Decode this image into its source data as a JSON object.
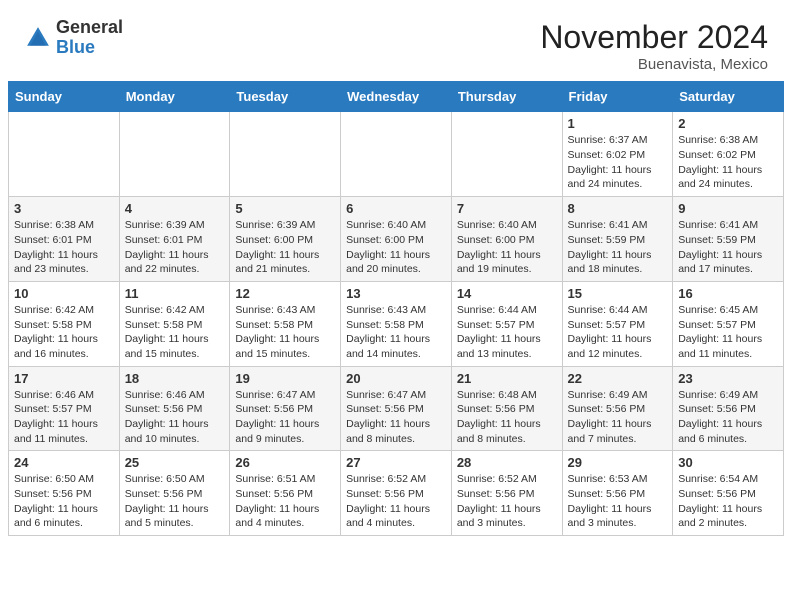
{
  "header": {
    "logo": {
      "general": "General",
      "blue": "Blue"
    },
    "title": "November 2024",
    "location": "Buenavista, Mexico"
  },
  "days_of_week": [
    "Sunday",
    "Monday",
    "Tuesday",
    "Wednesday",
    "Thursday",
    "Friday",
    "Saturday"
  ],
  "weeks": [
    [
      {
        "day": "",
        "info": ""
      },
      {
        "day": "",
        "info": ""
      },
      {
        "day": "",
        "info": ""
      },
      {
        "day": "",
        "info": ""
      },
      {
        "day": "",
        "info": ""
      },
      {
        "day": "1",
        "info": "Sunrise: 6:37 AM\nSunset: 6:02 PM\nDaylight: 11 hours and 24 minutes."
      },
      {
        "day": "2",
        "info": "Sunrise: 6:38 AM\nSunset: 6:02 PM\nDaylight: 11 hours and 24 minutes."
      }
    ],
    [
      {
        "day": "3",
        "info": "Sunrise: 6:38 AM\nSunset: 6:01 PM\nDaylight: 11 hours and 23 minutes."
      },
      {
        "day": "4",
        "info": "Sunrise: 6:39 AM\nSunset: 6:01 PM\nDaylight: 11 hours and 22 minutes."
      },
      {
        "day": "5",
        "info": "Sunrise: 6:39 AM\nSunset: 6:00 PM\nDaylight: 11 hours and 21 minutes."
      },
      {
        "day": "6",
        "info": "Sunrise: 6:40 AM\nSunset: 6:00 PM\nDaylight: 11 hours and 20 minutes."
      },
      {
        "day": "7",
        "info": "Sunrise: 6:40 AM\nSunset: 6:00 PM\nDaylight: 11 hours and 19 minutes."
      },
      {
        "day": "8",
        "info": "Sunrise: 6:41 AM\nSunset: 5:59 PM\nDaylight: 11 hours and 18 minutes."
      },
      {
        "day": "9",
        "info": "Sunrise: 6:41 AM\nSunset: 5:59 PM\nDaylight: 11 hours and 17 minutes."
      }
    ],
    [
      {
        "day": "10",
        "info": "Sunrise: 6:42 AM\nSunset: 5:58 PM\nDaylight: 11 hours and 16 minutes."
      },
      {
        "day": "11",
        "info": "Sunrise: 6:42 AM\nSunset: 5:58 PM\nDaylight: 11 hours and 15 minutes."
      },
      {
        "day": "12",
        "info": "Sunrise: 6:43 AM\nSunset: 5:58 PM\nDaylight: 11 hours and 15 minutes."
      },
      {
        "day": "13",
        "info": "Sunrise: 6:43 AM\nSunset: 5:58 PM\nDaylight: 11 hours and 14 minutes."
      },
      {
        "day": "14",
        "info": "Sunrise: 6:44 AM\nSunset: 5:57 PM\nDaylight: 11 hours and 13 minutes."
      },
      {
        "day": "15",
        "info": "Sunrise: 6:44 AM\nSunset: 5:57 PM\nDaylight: 11 hours and 12 minutes."
      },
      {
        "day": "16",
        "info": "Sunrise: 6:45 AM\nSunset: 5:57 PM\nDaylight: 11 hours and 11 minutes."
      }
    ],
    [
      {
        "day": "17",
        "info": "Sunrise: 6:46 AM\nSunset: 5:57 PM\nDaylight: 11 hours and 11 minutes."
      },
      {
        "day": "18",
        "info": "Sunrise: 6:46 AM\nSunset: 5:56 PM\nDaylight: 11 hours and 10 minutes."
      },
      {
        "day": "19",
        "info": "Sunrise: 6:47 AM\nSunset: 5:56 PM\nDaylight: 11 hours and 9 minutes."
      },
      {
        "day": "20",
        "info": "Sunrise: 6:47 AM\nSunset: 5:56 PM\nDaylight: 11 hours and 8 minutes."
      },
      {
        "day": "21",
        "info": "Sunrise: 6:48 AM\nSunset: 5:56 PM\nDaylight: 11 hours and 8 minutes."
      },
      {
        "day": "22",
        "info": "Sunrise: 6:49 AM\nSunset: 5:56 PM\nDaylight: 11 hours and 7 minutes."
      },
      {
        "day": "23",
        "info": "Sunrise: 6:49 AM\nSunset: 5:56 PM\nDaylight: 11 hours and 6 minutes."
      }
    ],
    [
      {
        "day": "24",
        "info": "Sunrise: 6:50 AM\nSunset: 5:56 PM\nDaylight: 11 hours and 6 minutes."
      },
      {
        "day": "25",
        "info": "Sunrise: 6:50 AM\nSunset: 5:56 PM\nDaylight: 11 hours and 5 minutes."
      },
      {
        "day": "26",
        "info": "Sunrise: 6:51 AM\nSunset: 5:56 PM\nDaylight: 11 hours and 4 minutes."
      },
      {
        "day": "27",
        "info": "Sunrise: 6:52 AM\nSunset: 5:56 PM\nDaylight: 11 hours and 4 minutes."
      },
      {
        "day": "28",
        "info": "Sunrise: 6:52 AM\nSunset: 5:56 PM\nDaylight: 11 hours and 3 minutes."
      },
      {
        "day": "29",
        "info": "Sunrise: 6:53 AM\nSunset: 5:56 PM\nDaylight: 11 hours and 3 minutes."
      },
      {
        "day": "30",
        "info": "Sunrise: 6:54 AM\nSunset: 5:56 PM\nDaylight: 11 hours and 2 minutes."
      }
    ]
  ]
}
